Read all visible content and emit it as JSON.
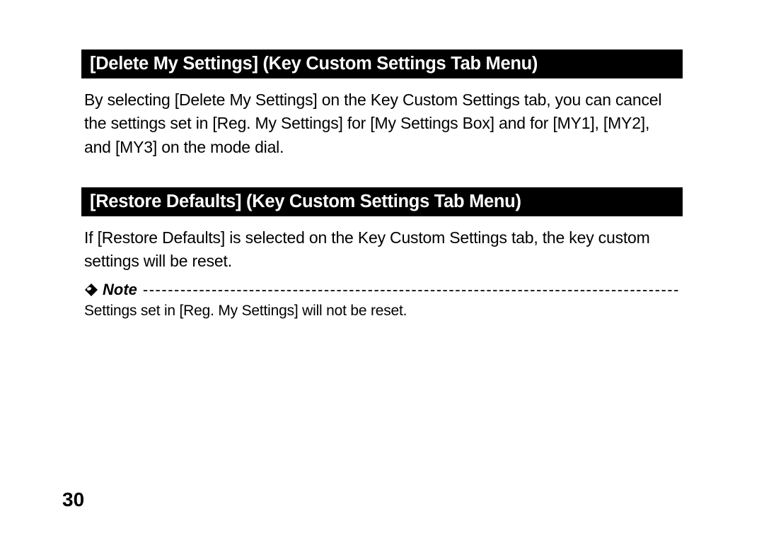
{
  "sections": [
    {
      "header": "[Delete My Settings] (Key Custom Settings Tab Menu)",
      "body": "By selecting [Delete My Settings] on the Key Custom Settings tab, you can cancel the settings set in [Reg. My Settings] for [My Settings Box] and for [MY1], [MY2], and [MY3] on the mode dial."
    },
    {
      "header": "[Restore Defaults] (Key Custom Settings Tab Menu)",
      "body": "If [Restore Defaults] is selected on the Key Custom Settings tab, the key custom settings will be reset."
    }
  ],
  "note": {
    "label": "Note",
    "body": "Settings set in [Reg. My Settings] will not be reset."
  },
  "pageNumber": "30"
}
